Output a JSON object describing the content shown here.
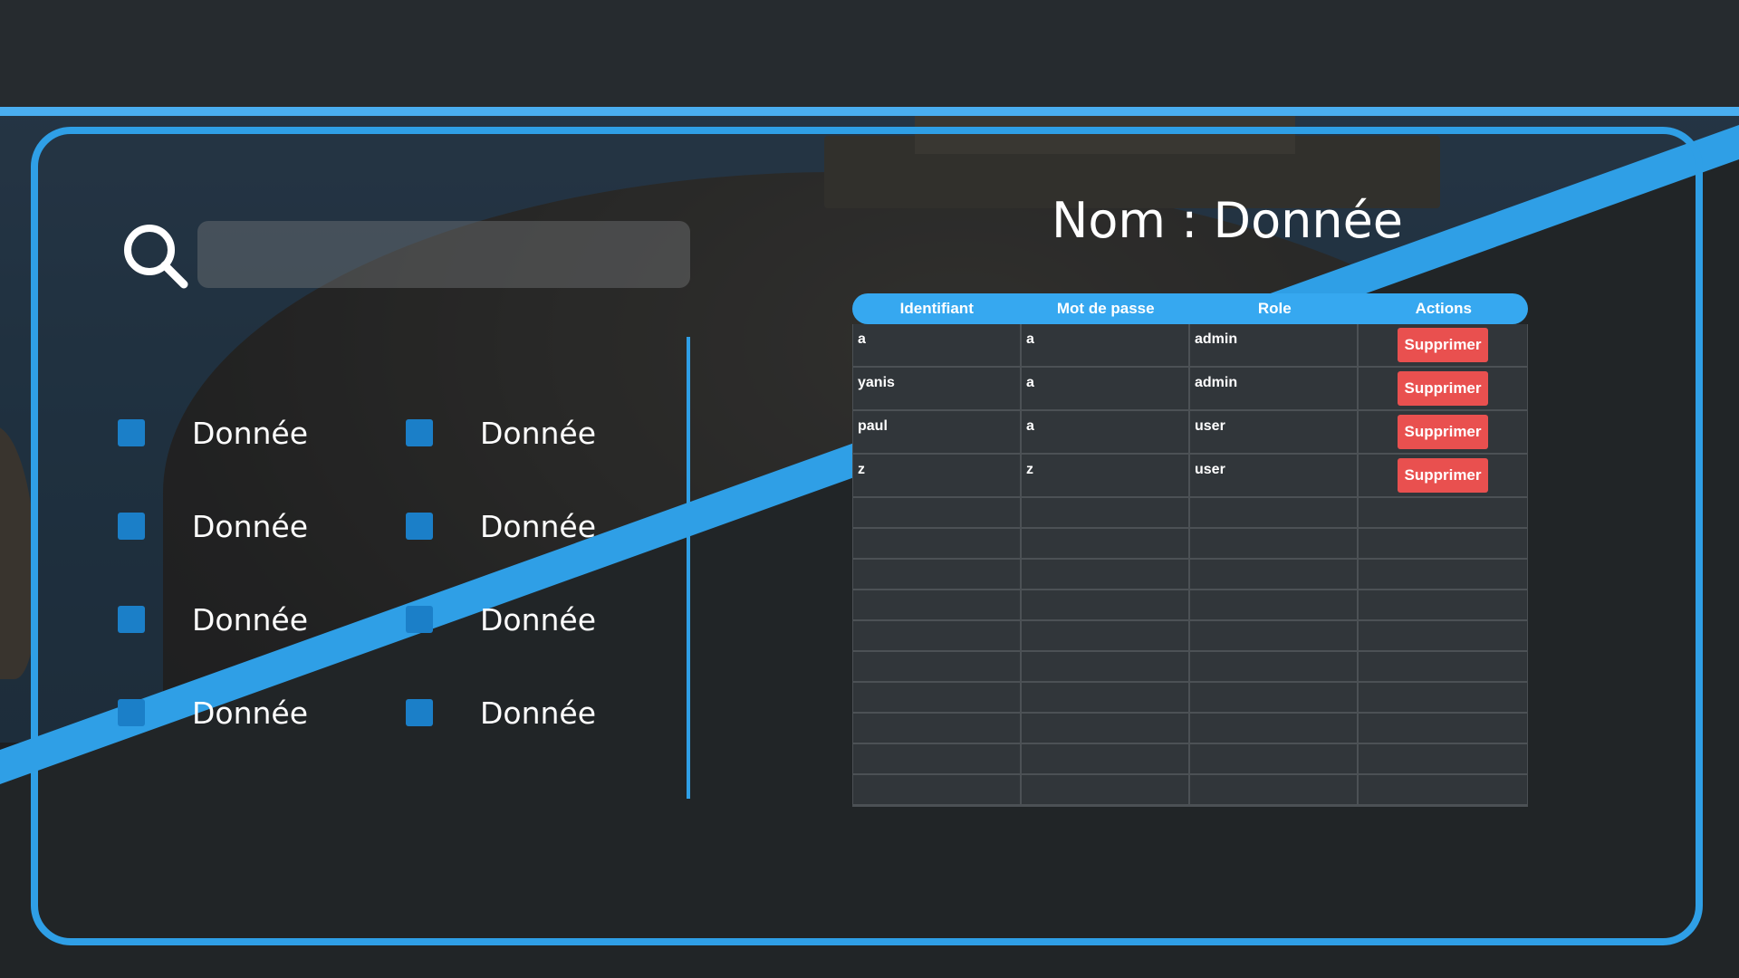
{
  "search": {
    "value": "",
    "placeholder": ""
  },
  "title": "Nom : Donnée",
  "data_items": [
    "Donnée",
    "Donnée",
    "Donnée",
    "Donnée",
    "Donnée",
    "Donnée",
    "Donnée",
    "Donnée"
  ],
  "table": {
    "headers": [
      "Identifiant",
      "Mot de passe",
      "Role",
      "Actions"
    ],
    "rows": [
      {
        "identifiant": "a",
        "mot_de_passe": "a",
        "role": "admin",
        "action": "Supprimer"
      },
      {
        "identifiant": "yanis",
        "mot_de_passe": "a",
        "role": "admin",
        "action": "Supprimer"
      },
      {
        "identifiant": "paul",
        "mot_de_passe": "a",
        "role": "user",
        "action": "Supprimer"
      },
      {
        "identifiant": "z",
        "mot_de_passe": "z",
        "role": "user",
        "action": "Supprimer"
      }
    ]
  },
  "icons": {
    "search": "search-icon",
    "checkbox": "square-icon"
  },
  "colors": {
    "accent": "#2f9fe6",
    "header": "#36a8f0",
    "delete": "#e9504f",
    "panel_bg": "#262a2d"
  }
}
